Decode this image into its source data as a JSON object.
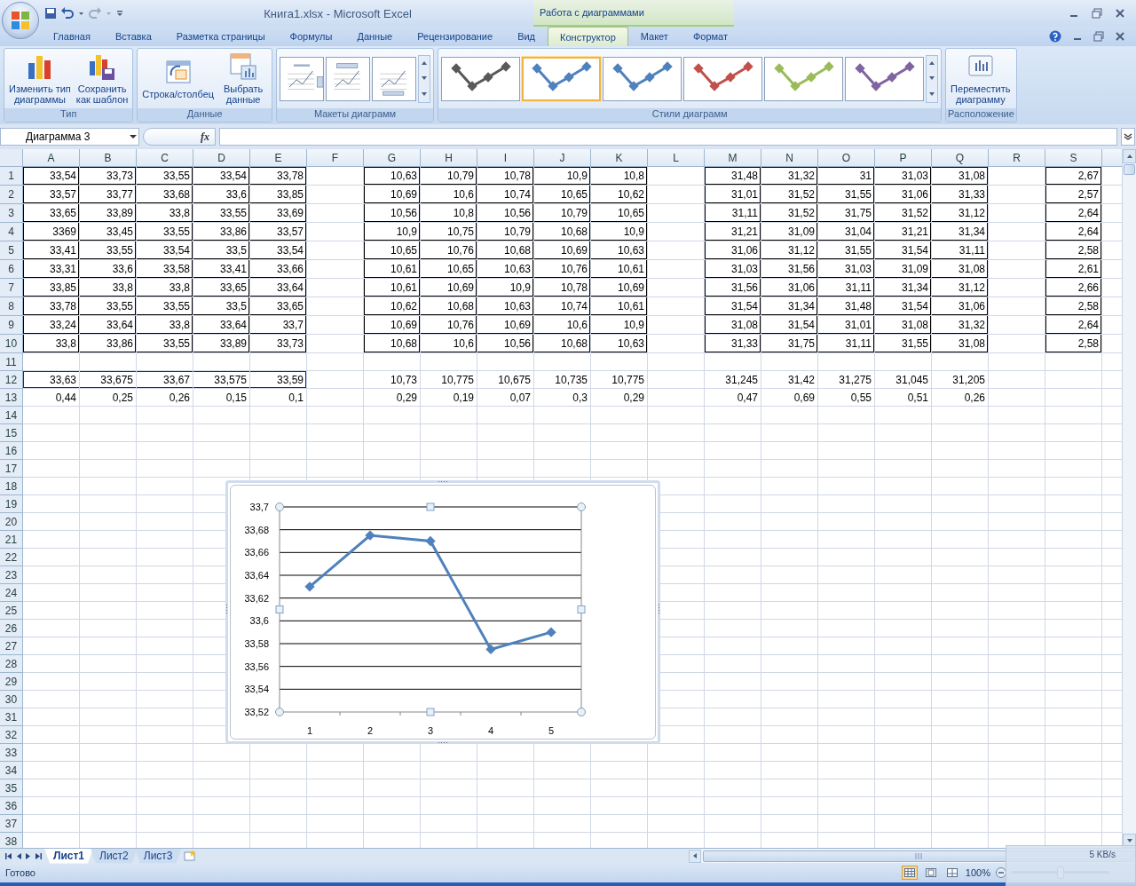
{
  "title_bar": {
    "title": "Книга1.xlsx - Microsoft Excel",
    "context_header": "Работа с диаграммами"
  },
  "ribbon_tabs": [
    {
      "label": "Главная",
      "selected": false
    },
    {
      "label": "Вставка",
      "selected": false
    },
    {
      "label": "Разметка страницы",
      "selected": false
    },
    {
      "label": "Формулы",
      "selected": false
    },
    {
      "label": "Данные",
      "selected": false
    },
    {
      "label": "Рецензирование",
      "selected": false
    },
    {
      "label": "Вид",
      "selected": false
    },
    {
      "label": "Конструктор",
      "selected": true
    },
    {
      "label": "Макет",
      "selected": false
    },
    {
      "label": "Формат",
      "selected": false
    }
  ],
  "ribbon_groups": [
    {
      "kind": "buttons",
      "label": "Тип",
      "buttons": [
        {
          "label": "Изменить тип\nдиаграммы"
        },
        {
          "label": "Сохранить\nкак шаблон"
        }
      ]
    },
    {
      "kind": "buttons",
      "label": "Данные",
      "buttons": [
        {
          "label": "Строка/столбец"
        },
        {
          "label": "Выбрать\nданные"
        }
      ]
    },
    {
      "kind": "layouts",
      "label": "Макеты диаграмм",
      "items": [
        {
          "selected": false
        },
        {
          "selected": false
        },
        {
          "selected": false
        }
      ]
    },
    {
      "kind": "styles",
      "label": "Стили диаграмм",
      "items": [
        {
          "color": "#595959",
          "selected": false
        },
        {
          "color": "#4f81bd",
          "selected": true
        },
        {
          "color": "#4f81bd",
          "selected": false
        },
        {
          "color": "#c0504d",
          "selected": false
        },
        {
          "color": "#9bbb59",
          "selected": false
        },
        {
          "color": "#8064a2",
          "selected": false
        }
      ]
    },
    {
      "kind": "buttons",
      "label": "Расположение",
      "buttons": [
        {
          "label": "Переместить\nдиаграмму"
        }
      ]
    }
  ],
  "formula_bar": {
    "name_box": "Диаграмма 3",
    "function_label": "fx"
  },
  "sheet": {
    "columns": [
      "A",
      "B",
      "C",
      "D",
      "E",
      "F",
      "G",
      "H",
      "I",
      "J",
      "K",
      "L",
      "M",
      "N",
      "O",
      "P",
      "Q",
      "R",
      "S"
    ],
    "rows": [
      {
        "number": "1",
        "bordered": true,
        "cells": [
          "33,54",
          "33,73",
          "33,55",
          "33,54",
          "33,78",
          null,
          "10,63",
          "10,79",
          "10,78",
          "10,9",
          "10,8",
          null,
          "31,48",
          "31,32",
          "31",
          "31,03",
          "31,08",
          null,
          "2,67"
        ]
      },
      {
        "number": "2",
        "bordered": true,
        "cells": [
          "33,57",
          "33,77",
          "33,68",
          "33,6",
          "33,85",
          null,
          "10,69",
          "10,6",
          "10,74",
          "10,65",
          "10,62",
          null,
          "31,01",
          "31,52",
          "31,55",
          "31,06",
          "31,33",
          null,
          "2,57"
        ]
      },
      {
        "number": "3",
        "bordered": true,
        "cells": [
          "33,65",
          "33,89",
          "33,8",
          "33,55",
          "33,69",
          null,
          "10,56",
          "10,8",
          "10,56",
          "10,79",
          "10,65",
          null,
          "31,11",
          "31,52",
          "31,75",
          "31,52",
          "31,12",
          null,
          "2,64"
        ]
      },
      {
        "number": "4",
        "bordered": true,
        "cells": [
          "3369",
          "33,45",
          "33,55",
          "33,86",
          "33,57",
          null,
          "10,9",
          "10,75",
          "10,79",
          "10,68",
          "10,9",
          null,
          "31,21",
          "31,09",
          "31,04",
          "31,21",
          "31,34",
          null,
          "2,64"
        ]
      },
      {
        "number": "5",
        "bordered": true,
        "cells": [
          "33,41",
          "33,55",
          "33,54",
          "33,5",
          "33,54",
          null,
          "10,65",
          "10,76",
          "10,68",
          "10,69",
          "10,63",
          null,
          "31,06",
          "31,12",
          "31,55",
          "31,54",
          "31,11",
          null,
          "2,58"
        ]
      },
      {
        "number": "6",
        "bordered": true,
        "cells": [
          "33,31",
          "33,6",
          "33,58",
          "33,41",
          "33,66",
          null,
          "10,61",
          "10,65",
          "10,63",
          "10,76",
          "10,61",
          null,
          "31,03",
          "31,56",
          "31,03",
          "31,09",
          "31,08",
          null,
          "2,61"
        ]
      },
      {
        "number": "7",
        "bordered": true,
        "cells": [
          "33,85",
          "33,8",
          "33,8",
          "33,65",
          "33,64",
          null,
          "10,61",
          "10,69",
          "10,9",
          "10,78",
          "10,69",
          null,
          "31,56",
          "31,06",
          "31,11",
          "31,34",
          "31,12",
          null,
          "2,66"
        ]
      },
      {
        "number": "8",
        "bordered": true,
        "cells": [
          "33,78",
          "33,55",
          "33,55",
          "33,5",
          "33,65",
          null,
          "10,62",
          "10,68",
          "10,63",
          "10,74",
          "10,61",
          null,
          "31,54",
          "31,34",
          "31,48",
          "31,54",
          "31,06",
          null,
          "2,58"
        ]
      },
      {
        "number": "9",
        "bordered": true,
        "cells": [
          "33,24",
          "33,64",
          "33,8",
          "33,64",
          "33,7",
          null,
          "10,69",
          "10,76",
          "10,69",
          "10,6",
          "10,9",
          null,
          "31,08",
          "31,54",
          "31,01",
          "31,08",
          "31,32",
          null,
          "2,64"
        ]
      },
      {
        "number": "10",
        "bordered": true,
        "cells": [
          "33,8",
          "33,86",
          "33,55",
          "33,89",
          "33,73",
          null,
          "10,68",
          "10,6",
          "10,56",
          "10,68",
          "10,63",
          null,
          "31,33",
          "31,75",
          "31,11",
          "31,55",
          "31,08",
          null,
          "2,58"
        ]
      },
      {
        "number": "11",
        "bordered": false,
        "cells": []
      },
      {
        "number": "12",
        "bordered": false,
        "cells": [
          {
            "value": "33,63",
            "selected": true
          },
          {
            "value": "33,675",
            "selected": true
          },
          {
            "value": "33,67",
            "selected": true
          },
          {
            "value": "33,575",
            "selected": true
          },
          {
            "value": "33,59",
            "selected": true
          },
          null,
          "10,73",
          "10,775",
          "10,675",
          "10,735",
          "10,775",
          null,
          "31,245",
          "31,42",
          "31,275",
          "31,045",
          "31,205"
        ]
      },
      {
        "number": "13",
        "bordered": false,
        "cells": [
          "0,44",
          "0,25",
          "0,26",
          "0,15",
          "0,1",
          null,
          "0,29",
          "0,19",
          "0,07",
          "0,3",
          "0,29",
          null,
          "0,47",
          "0,69",
          "0,55",
          "0,51",
          "0,26"
        ]
      },
      {
        "number": "14",
        "bordered": false,
        "cells": []
      },
      {
        "number": "15",
        "bordered": false,
        "cells": []
      },
      {
        "number": "16",
        "bordered": false,
        "cells": []
      },
      {
        "number": "17",
        "bordered": false,
        "cells": []
      },
      {
        "number": "18",
        "bordered": false,
        "cells": []
      },
      {
        "number": "19",
        "bordered": false,
        "cells": []
      },
      {
        "number": "20",
        "bordered": false,
        "cells": []
      },
      {
        "number": "21",
        "bordered": false,
        "cells": []
      },
      {
        "number": "22",
        "bordered": false,
        "cells": []
      },
      {
        "number": "23",
        "bordered": false,
        "cells": []
      },
      {
        "number": "24",
        "bordered": false,
        "cells": []
      },
      {
        "number": "25",
        "bordered": false,
        "cells": []
      },
      {
        "number": "26",
        "bordered": false,
        "cells": []
      },
      {
        "number": "27",
        "bordered": false,
        "cells": []
      },
      {
        "number": "28",
        "bordered": false,
        "cells": []
      },
      {
        "number": "29",
        "bordered": false,
        "cells": []
      },
      {
        "number": "30",
        "bordered": false,
        "cells": []
      },
      {
        "number": "31",
        "bordered": false,
        "cells": []
      },
      {
        "number": "32",
        "bordered": false,
        "cells": []
      },
      {
        "number": "33",
        "bordered": false,
        "cells": []
      },
      {
        "number": "34",
        "bordered": false,
        "cells": []
      },
      {
        "number": "35",
        "bordered": false,
        "cells": []
      },
      {
        "number": "36",
        "bordered": false,
        "cells": []
      },
      {
        "number": "37",
        "bordered": false,
        "cells": []
      },
      {
        "number": "38",
        "bordered": false,
        "cells": []
      }
    ]
  },
  "chart": {
    "chart_data": {
      "type": "line",
      "grid": true,
      "categories": [
        "1",
        "2",
        "3",
        "4",
        "5"
      ],
      "series": [
        {
          "color": "#4f81bd",
          "marker": "diamond",
          "values": [
            33.63,
            33.675,
            33.67,
            33.575,
            33.59
          ]
        }
      ],
      "ylim": [
        33.52,
        33.7
      ],
      "yticks": [
        {
          "value": 33.52,
          "label": "33,52"
        },
        {
          "value": 33.54,
          "label": "33,54"
        },
        {
          "value": 33.56,
          "label": "33,56"
        },
        {
          "value": 33.58,
          "label": "33,58"
        },
        {
          "value": 33.6,
          "label": "33,6"
        },
        {
          "value": 33.62,
          "label": "33,62"
        },
        {
          "value": 33.64,
          "label": "33,64"
        },
        {
          "value": 33.66,
          "label": "33,66"
        },
        {
          "value": 33.68,
          "label": "33,68"
        },
        {
          "value": 33.7,
          "label": "33,7"
        }
      ]
    }
  },
  "sheet_tabs": [
    {
      "label": "Лист1",
      "selected": true
    },
    {
      "label": "Лист2",
      "selected": false
    },
    {
      "label": "Лист3",
      "selected": false
    }
  ],
  "status_bar": {
    "text": "Готово",
    "views": [
      {
        "selected": true
      },
      {
        "selected": false
      },
      {
        "selected": false
      }
    ],
    "zoom": "100%",
    "zoom_slider": {
      "level": 0.5
    },
    "network_speed": "5 KB/s"
  }
}
